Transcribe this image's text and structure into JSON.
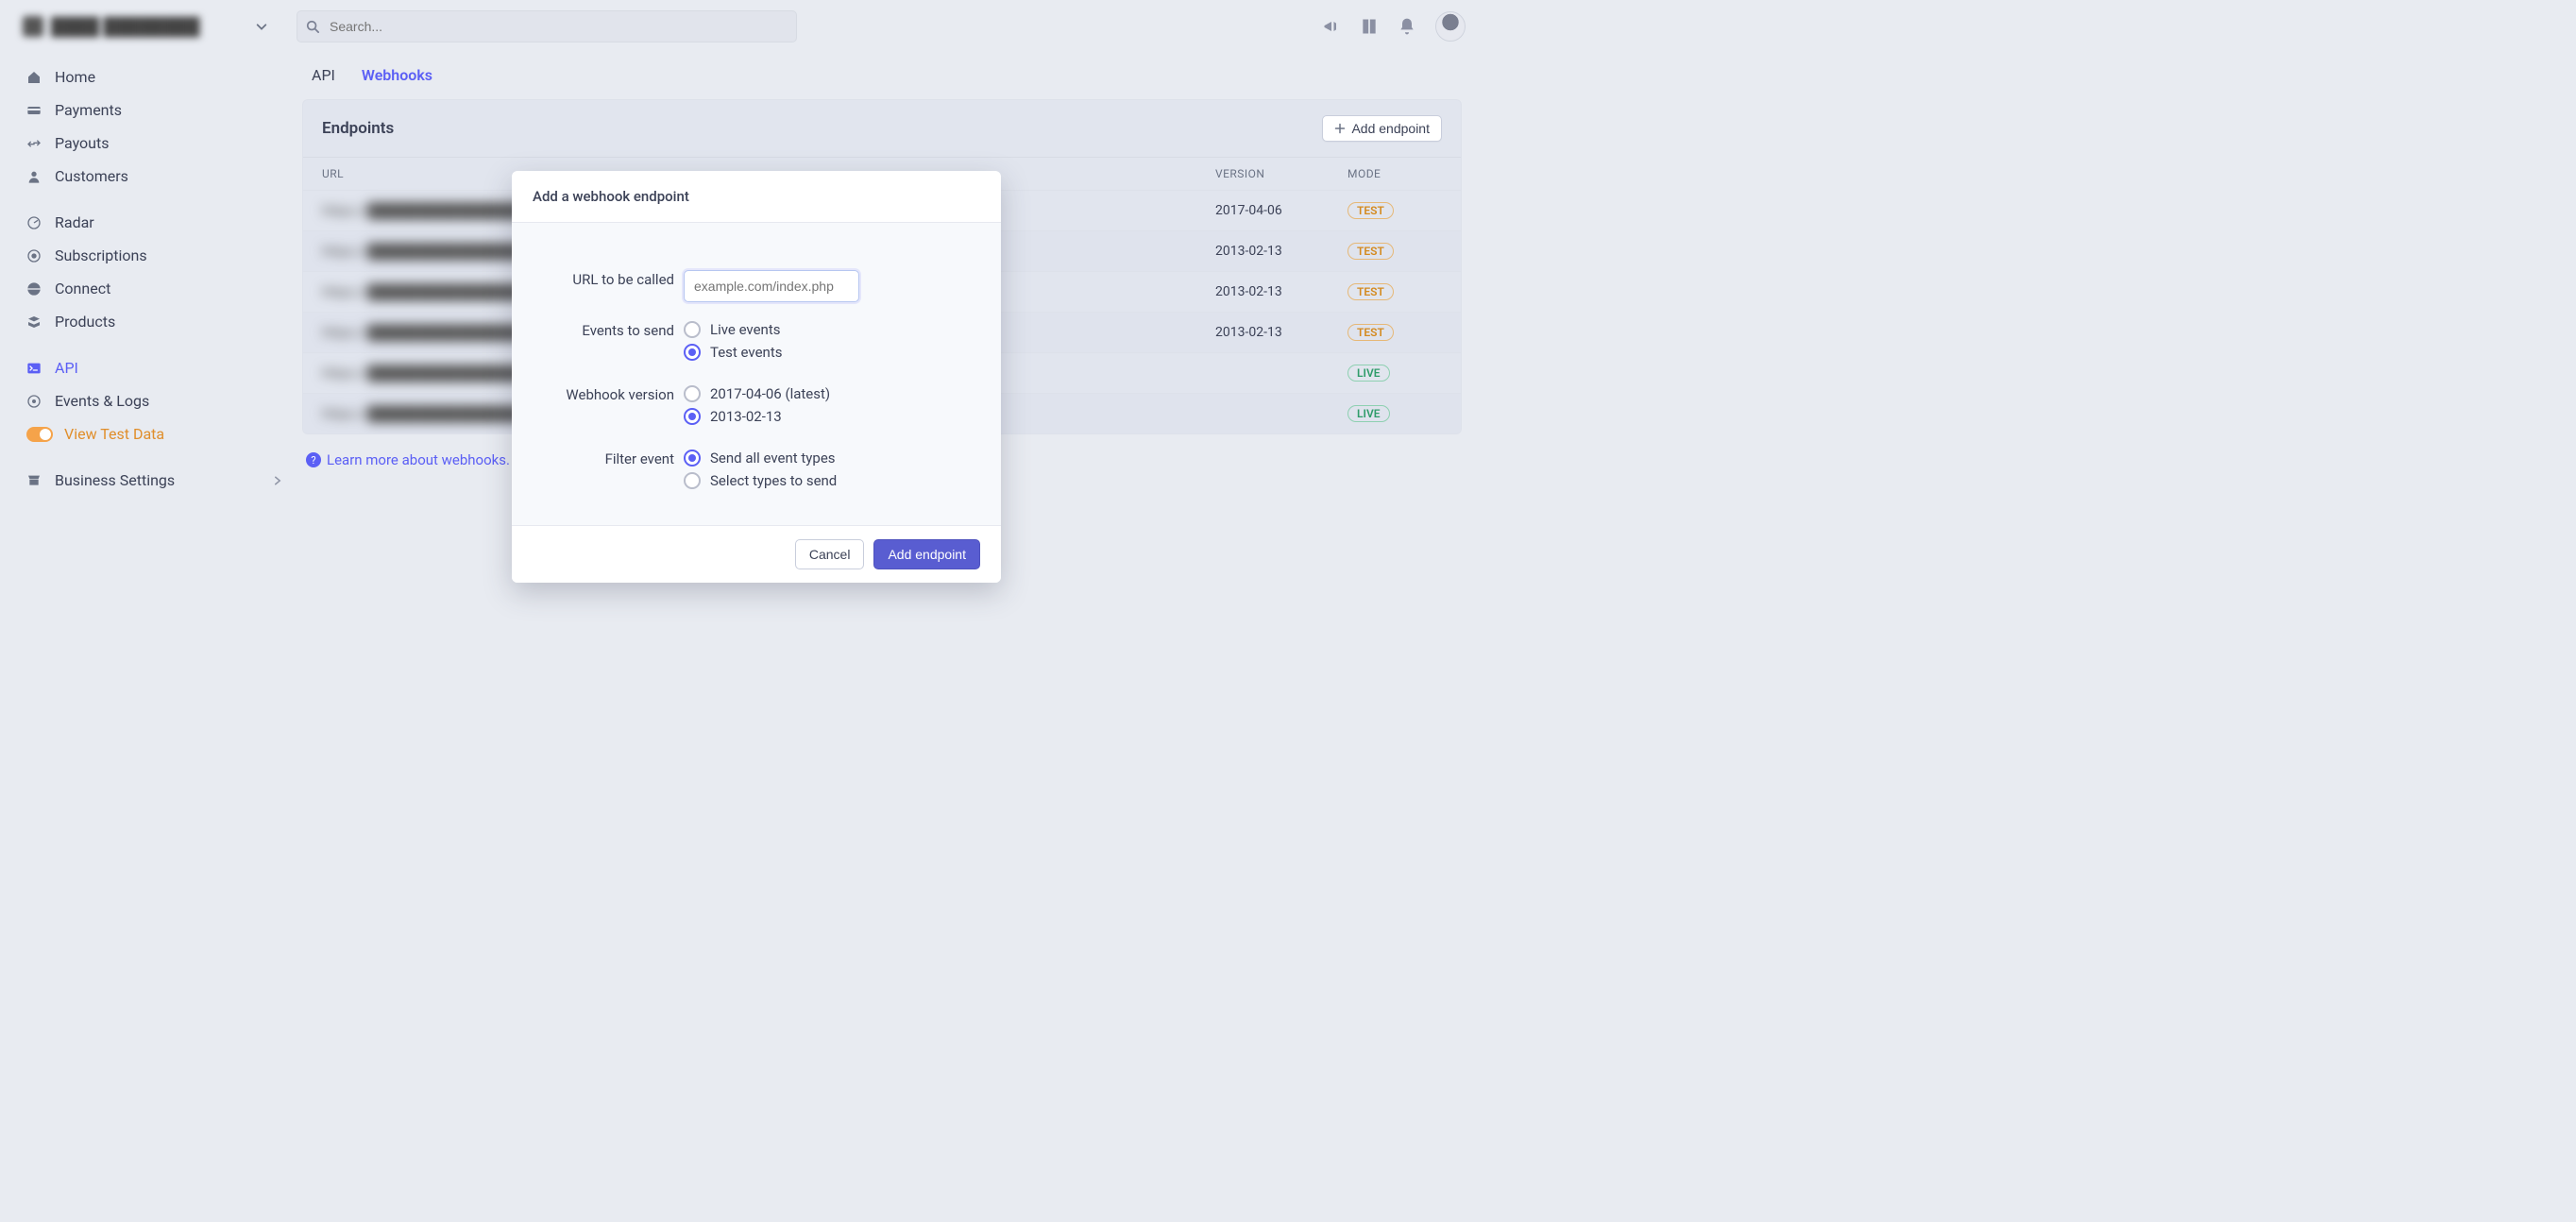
{
  "search": {
    "placeholder": "Search..."
  },
  "sidebar": {
    "items": [
      {
        "label": "Home",
        "icon": "home-icon"
      },
      {
        "label": "Payments",
        "icon": "payments-icon"
      },
      {
        "label": "Payouts",
        "icon": "payouts-icon"
      },
      {
        "label": "Customers",
        "icon": "customers-icon"
      }
    ],
    "items2": [
      {
        "label": "Radar",
        "icon": "radar-icon"
      },
      {
        "label": "Subscriptions",
        "icon": "subscriptions-icon"
      },
      {
        "label": "Connect",
        "icon": "connect-icon"
      },
      {
        "label": "Products",
        "icon": "products-icon"
      }
    ],
    "api_label": "API",
    "events_label": "Events & Logs",
    "view_test_label": "View Test Data",
    "business_label": "Business Settings"
  },
  "tabs": {
    "api": "API",
    "webhooks": "Webhooks"
  },
  "panel": {
    "title": "Endpoints",
    "add_btn": "Add endpoint",
    "col_url": "URL",
    "col_version": "VERSION",
    "col_mode": "MODE"
  },
  "rows": [
    {
      "version": "2017-04-06",
      "mode": "TEST",
      "mode_kind": "test"
    },
    {
      "version": "2013-02-13",
      "mode": "TEST",
      "mode_kind": "test"
    },
    {
      "version": "2013-02-13",
      "mode": "TEST",
      "mode_kind": "test"
    },
    {
      "version": "2013-02-13",
      "mode": "TEST",
      "mode_kind": "test"
    },
    {
      "version": "",
      "mode": "LIVE",
      "mode_kind": "live"
    },
    {
      "version": "",
      "mode": "LIVE",
      "mode_kind": "live"
    }
  ],
  "learn_more": "Learn more about webhooks.",
  "modal": {
    "title": "Add a webhook endpoint",
    "url_label": "URL to be called",
    "url_placeholder": "example.com/index.php",
    "events_label": "Events to send",
    "events_live": "Live events",
    "events_test": "Test events",
    "version_label": "Webhook version",
    "version_latest": "2017-04-06 (latest)",
    "version_other": "2013-02-13",
    "filter_label": "Filter event",
    "filter_all": "Send all event types",
    "filter_select": "Select types to send",
    "cancel": "Cancel",
    "submit": "Add endpoint"
  }
}
